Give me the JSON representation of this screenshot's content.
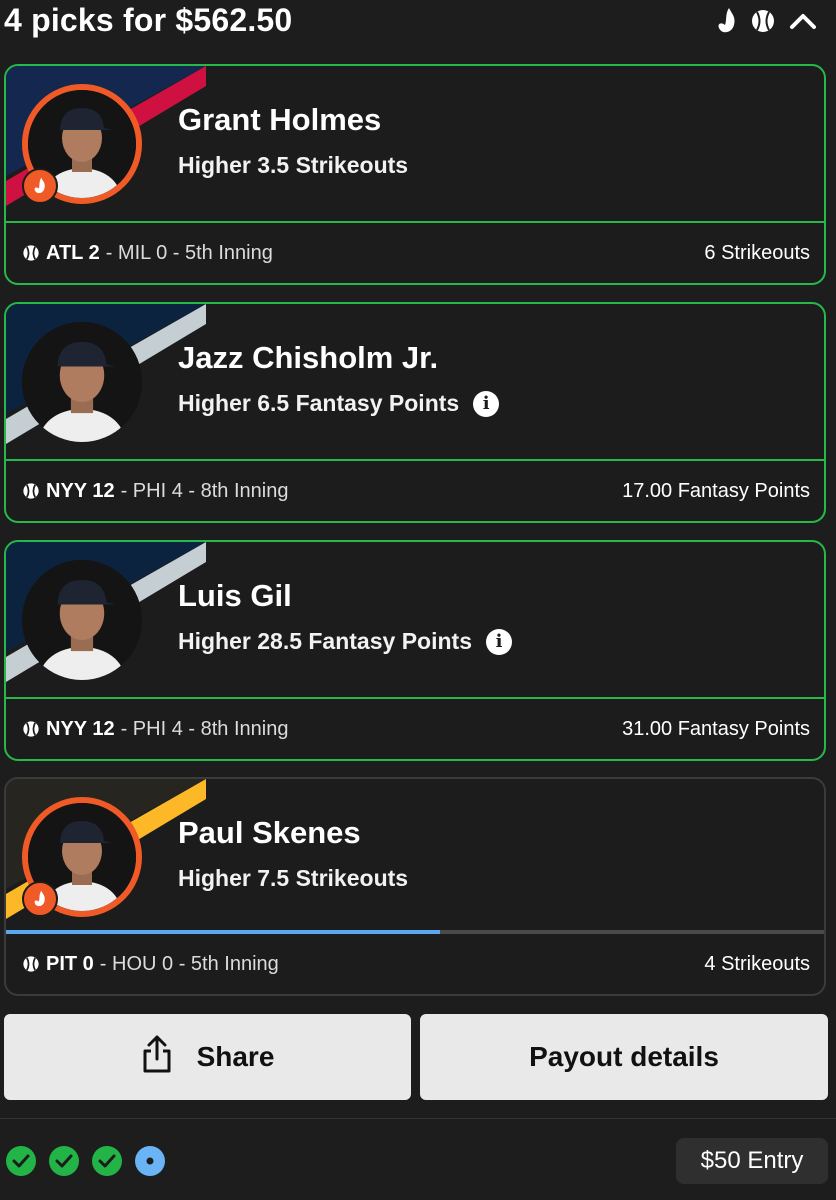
{
  "header": {
    "title": "4 picks for $562.50",
    "icons": [
      "flame-icon",
      "baseball-icon",
      "chevron-up-icon"
    ]
  },
  "picks": [
    {
      "player": "Grant Holmes",
      "line": "Higher 3.5 Strikeouts",
      "team_colors": [
        "#13274f",
        "#ce1141"
      ],
      "game_team": "ATL 2",
      "game_rest": "- MIL 0 - 5th Inning",
      "result": "6 Strikeouts",
      "status": "won",
      "hot": true,
      "info": false
    },
    {
      "player": "Jazz Chisholm Jr.",
      "line": "Higher 6.5 Fantasy Points",
      "team_colors": [
        "#0c2340",
        "#c4ced3"
      ],
      "game_team": "NYY 12",
      "game_rest": "- PHI 4 - 8th Inning",
      "result": "17.00 Fantasy Points",
      "status": "won",
      "hot": false,
      "info": true
    },
    {
      "player": "Luis Gil",
      "line": "Higher 28.5 Fantasy Points",
      "team_colors": [
        "#0c2340",
        "#c4ced3"
      ],
      "game_team": "NYY 12",
      "game_rest": "- PHI 4 - 8th Inning",
      "result": "31.00 Fantasy Points",
      "status": "won",
      "hot": false,
      "info": true
    },
    {
      "player": "Paul Skenes",
      "line": "Higher 7.5 Strikeouts",
      "team_colors": [
        "#27251f",
        "#fdb827"
      ],
      "game_team": "PIT 0",
      "game_rest": "- HOU 0 - 5th Inning",
      "result": "4 Strikeouts",
      "status": "live",
      "hot": true,
      "info": false,
      "progress": 0.53
    }
  ],
  "actions": {
    "share_label": "Share",
    "payout_label": "Payout details"
  },
  "footer": {
    "entry_label": "$50 Entry",
    "pick_states": [
      "won",
      "won",
      "won",
      "live"
    ]
  },
  "colors": {
    "win": "#27b84a",
    "live": "#5aa7f0",
    "hot": "#ef5a26"
  }
}
